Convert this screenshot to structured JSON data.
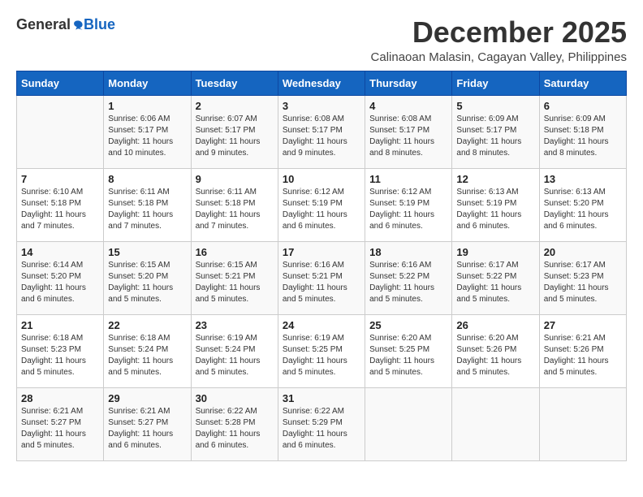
{
  "header": {
    "logo_general": "General",
    "logo_blue": "Blue",
    "month_title": "December 2025",
    "location": "Calinaoan Malasin, Cagayan Valley, Philippines"
  },
  "weekdays": [
    "Sunday",
    "Monday",
    "Tuesday",
    "Wednesday",
    "Thursday",
    "Friday",
    "Saturday"
  ],
  "weeks": [
    [
      {
        "day": "",
        "info": ""
      },
      {
        "day": "1",
        "info": "Sunrise: 6:06 AM\nSunset: 5:17 PM\nDaylight: 11 hours\nand 10 minutes."
      },
      {
        "day": "2",
        "info": "Sunrise: 6:07 AM\nSunset: 5:17 PM\nDaylight: 11 hours\nand 9 minutes."
      },
      {
        "day": "3",
        "info": "Sunrise: 6:08 AM\nSunset: 5:17 PM\nDaylight: 11 hours\nand 9 minutes."
      },
      {
        "day": "4",
        "info": "Sunrise: 6:08 AM\nSunset: 5:17 PM\nDaylight: 11 hours\nand 8 minutes."
      },
      {
        "day": "5",
        "info": "Sunrise: 6:09 AM\nSunset: 5:17 PM\nDaylight: 11 hours\nand 8 minutes."
      },
      {
        "day": "6",
        "info": "Sunrise: 6:09 AM\nSunset: 5:18 PM\nDaylight: 11 hours\nand 8 minutes."
      }
    ],
    [
      {
        "day": "7",
        "info": "Sunrise: 6:10 AM\nSunset: 5:18 PM\nDaylight: 11 hours\nand 7 minutes."
      },
      {
        "day": "8",
        "info": "Sunrise: 6:11 AM\nSunset: 5:18 PM\nDaylight: 11 hours\nand 7 minutes."
      },
      {
        "day": "9",
        "info": "Sunrise: 6:11 AM\nSunset: 5:18 PM\nDaylight: 11 hours\nand 7 minutes."
      },
      {
        "day": "10",
        "info": "Sunrise: 6:12 AM\nSunset: 5:19 PM\nDaylight: 11 hours\nand 6 minutes."
      },
      {
        "day": "11",
        "info": "Sunrise: 6:12 AM\nSunset: 5:19 PM\nDaylight: 11 hours\nand 6 minutes."
      },
      {
        "day": "12",
        "info": "Sunrise: 6:13 AM\nSunset: 5:19 PM\nDaylight: 11 hours\nand 6 minutes."
      },
      {
        "day": "13",
        "info": "Sunrise: 6:13 AM\nSunset: 5:20 PM\nDaylight: 11 hours\nand 6 minutes."
      }
    ],
    [
      {
        "day": "14",
        "info": "Sunrise: 6:14 AM\nSunset: 5:20 PM\nDaylight: 11 hours\nand 6 minutes."
      },
      {
        "day": "15",
        "info": "Sunrise: 6:15 AM\nSunset: 5:20 PM\nDaylight: 11 hours\nand 5 minutes."
      },
      {
        "day": "16",
        "info": "Sunrise: 6:15 AM\nSunset: 5:21 PM\nDaylight: 11 hours\nand 5 minutes."
      },
      {
        "day": "17",
        "info": "Sunrise: 6:16 AM\nSunset: 5:21 PM\nDaylight: 11 hours\nand 5 minutes."
      },
      {
        "day": "18",
        "info": "Sunrise: 6:16 AM\nSunset: 5:22 PM\nDaylight: 11 hours\nand 5 minutes."
      },
      {
        "day": "19",
        "info": "Sunrise: 6:17 AM\nSunset: 5:22 PM\nDaylight: 11 hours\nand 5 minutes."
      },
      {
        "day": "20",
        "info": "Sunrise: 6:17 AM\nSunset: 5:23 PM\nDaylight: 11 hours\nand 5 minutes."
      }
    ],
    [
      {
        "day": "21",
        "info": "Sunrise: 6:18 AM\nSunset: 5:23 PM\nDaylight: 11 hours\nand 5 minutes."
      },
      {
        "day": "22",
        "info": "Sunrise: 6:18 AM\nSunset: 5:24 PM\nDaylight: 11 hours\nand 5 minutes."
      },
      {
        "day": "23",
        "info": "Sunrise: 6:19 AM\nSunset: 5:24 PM\nDaylight: 11 hours\nand 5 minutes."
      },
      {
        "day": "24",
        "info": "Sunrise: 6:19 AM\nSunset: 5:25 PM\nDaylight: 11 hours\nand 5 minutes."
      },
      {
        "day": "25",
        "info": "Sunrise: 6:20 AM\nSunset: 5:25 PM\nDaylight: 11 hours\nand 5 minutes."
      },
      {
        "day": "26",
        "info": "Sunrise: 6:20 AM\nSunset: 5:26 PM\nDaylight: 11 hours\nand 5 minutes."
      },
      {
        "day": "27",
        "info": "Sunrise: 6:21 AM\nSunset: 5:26 PM\nDaylight: 11 hours\nand 5 minutes."
      }
    ],
    [
      {
        "day": "28",
        "info": "Sunrise: 6:21 AM\nSunset: 5:27 PM\nDaylight: 11 hours\nand 5 minutes."
      },
      {
        "day": "29",
        "info": "Sunrise: 6:21 AM\nSunset: 5:27 PM\nDaylight: 11 hours\nand 6 minutes."
      },
      {
        "day": "30",
        "info": "Sunrise: 6:22 AM\nSunset: 5:28 PM\nDaylight: 11 hours\nand 6 minutes."
      },
      {
        "day": "31",
        "info": "Sunrise: 6:22 AM\nSunset: 5:29 PM\nDaylight: 11 hours\nand 6 minutes."
      },
      {
        "day": "",
        "info": ""
      },
      {
        "day": "",
        "info": ""
      },
      {
        "day": "",
        "info": ""
      }
    ]
  ]
}
